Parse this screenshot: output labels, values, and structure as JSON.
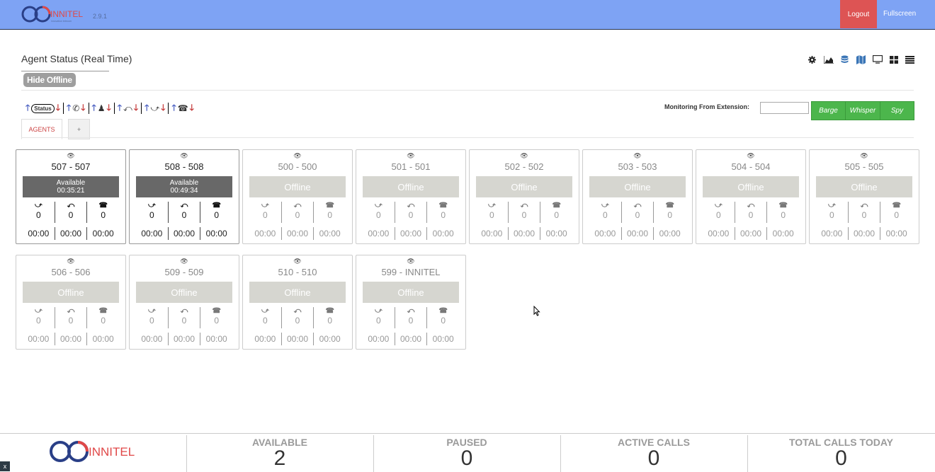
{
  "header": {
    "brand": "INNITEL",
    "tagline": "innovation telecom",
    "version": "2.9.1",
    "logout_label": "Logout",
    "fullscreen_label": "Fullscreen"
  },
  "page": {
    "title": "Agent Status (Real Time)",
    "hide_offline_label": "Hide Offline"
  },
  "toolbar_icons": [
    "gear-icon",
    "area-chart-icon",
    "database-icon",
    "map-icon",
    "monitor-icon",
    "grid-icon",
    "list-icon"
  ],
  "sort_bar": {
    "status_label": "Status"
  },
  "monitoring": {
    "label": "Monitoring From Extension:",
    "value": "",
    "barge_label": "Barge",
    "whisper_label": "Whisper",
    "spy_label": "Spy"
  },
  "tabs": {
    "agents_label": "AGENTS",
    "add_label": "+"
  },
  "agents": [
    {
      "name": "507 - 507",
      "state": "online",
      "status": "Available",
      "duration": "00:35:21",
      "inbound": "0",
      "outbound": "0",
      "internal": "0",
      "t1": "00:00",
      "t2": "00:00",
      "t3": "00:00"
    },
    {
      "name": "508 - 508",
      "state": "online",
      "status": "Available",
      "duration": "00:49:34",
      "inbound": "0",
      "outbound": "0",
      "internal": "0",
      "t1": "00:00",
      "t2": "00:00",
      "t3": "00:00"
    },
    {
      "name": "500 - 500",
      "state": "offline",
      "status": "Offline",
      "duration": "",
      "inbound": "0",
      "outbound": "0",
      "internal": "0",
      "t1": "00:00",
      "t2": "00:00",
      "t3": "00:00"
    },
    {
      "name": "501 - 501",
      "state": "offline",
      "status": "Offline",
      "duration": "",
      "inbound": "0",
      "outbound": "0",
      "internal": "0",
      "t1": "00:00",
      "t2": "00:00",
      "t3": "00:00"
    },
    {
      "name": "502 - 502",
      "state": "offline",
      "status": "Offline",
      "duration": "",
      "inbound": "0",
      "outbound": "0",
      "internal": "0",
      "t1": "00:00",
      "t2": "00:00",
      "t3": "00:00"
    },
    {
      "name": "503 - 503",
      "state": "offline",
      "status": "Offline",
      "duration": "",
      "inbound": "0",
      "outbound": "0",
      "internal": "0",
      "t1": "00:00",
      "t2": "00:00",
      "t3": "00:00"
    },
    {
      "name": "504 - 504",
      "state": "offline",
      "status": "Offline",
      "duration": "",
      "inbound": "0",
      "outbound": "0",
      "internal": "0",
      "t1": "00:00",
      "t2": "00:00",
      "t3": "00:00"
    },
    {
      "name": "505 - 505",
      "state": "offline",
      "status": "Offline",
      "duration": "",
      "inbound": "0",
      "outbound": "0",
      "internal": "0",
      "t1": "00:00",
      "t2": "00:00",
      "t3": "00:00"
    },
    {
      "name": "506 - 506",
      "state": "offline",
      "status": "Offline",
      "duration": "",
      "inbound": "0",
      "outbound": "0",
      "internal": "0",
      "t1": "00:00",
      "t2": "00:00",
      "t3": "00:00"
    },
    {
      "name": "509 - 509",
      "state": "offline",
      "status": "Offline",
      "duration": "",
      "inbound": "0",
      "outbound": "0",
      "internal": "0",
      "t1": "00:00",
      "t2": "00:00",
      "t3": "00:00"
    },
    {
      "name": "510 - 510",
      "state": "offline",
      "status": "Offline",
      "duration": "",
      "inbound": "0",
      "outbound": "0",
      "internal": "0",
      "t1": "00:00",
      "t2": "00:00",
      "t3": "00:00"
    },
    {
      "name": "599 - INNITEL",
      "state": "offline",
      "status": "Offline",
      "duration": "",
      "inbound": "0",
      "outbound": "0",
      "internal": "0",
      "t1": "00:00",
      "t2": "00:00",
      "t3": "00:00"
    }
  ],
  "footer": {
    "brand": "INNITEL",
    "available_label": "AVAILABLE",
    "available_value": "2",
    "paused_label": "PAUSED",
    "paused_value": "0",
    "active_calls_label": "ACTIVE CALLS",
    "active_calls_value": "0",
    "total_calls_label": "TOTAL CALLS TODAY",
    "total_calls_value": "0",
    "close_label": "x"
  },
  "colors": {
    "topbar": "#7ea3f4",
    "logout": "#dd5454",
    "action_green": "#4cb64c",
    "online_status": "#686868",
    "offline_status": "#d6d6d0"
  }
}
